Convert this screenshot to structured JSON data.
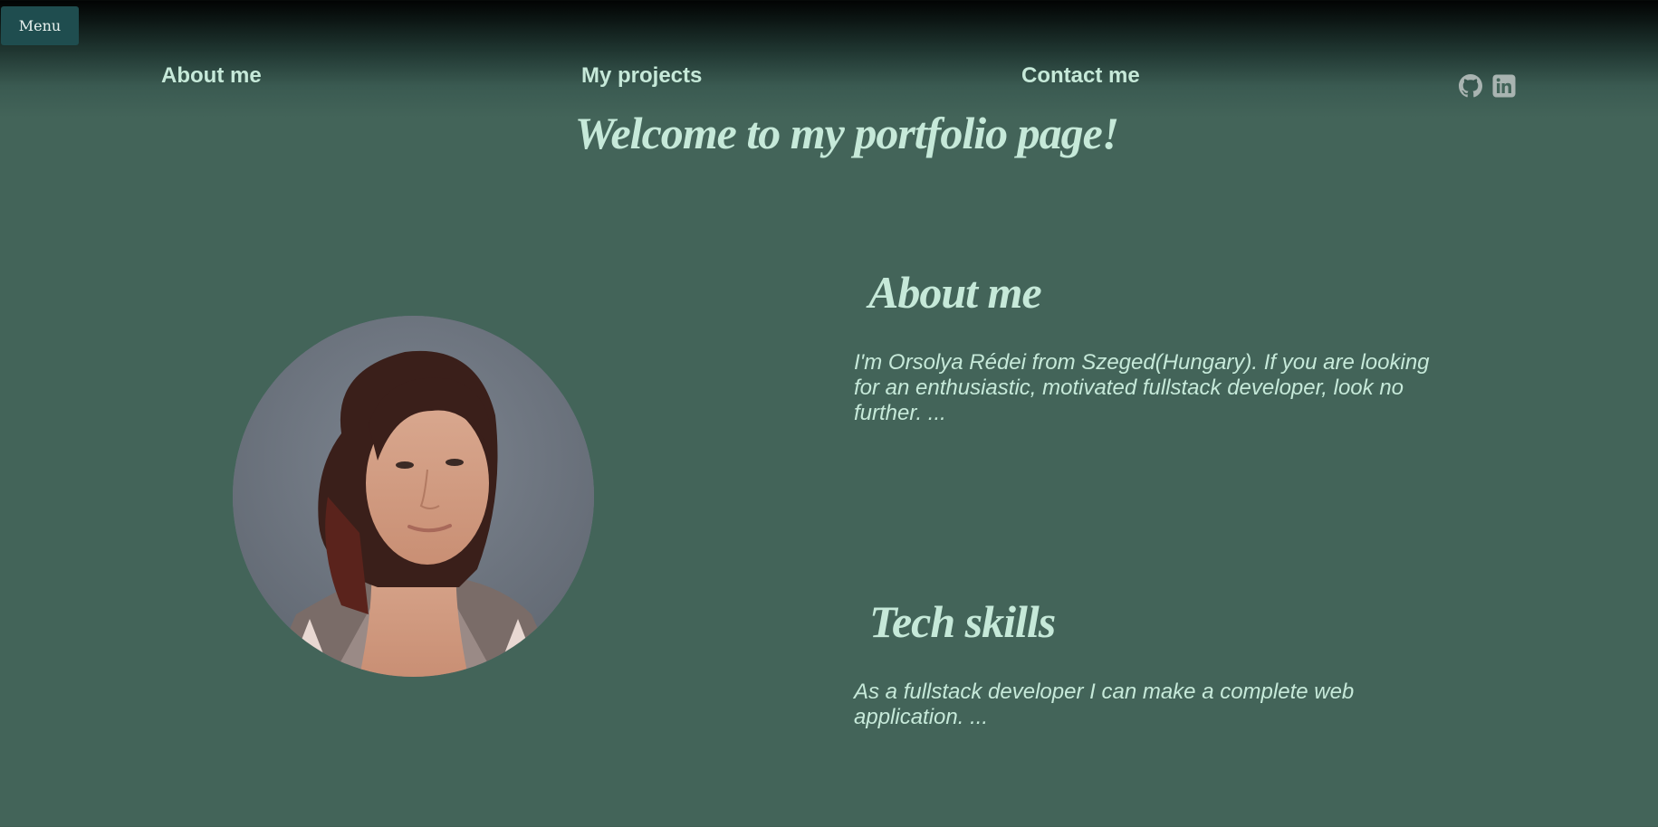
{
  "menu": {
    "label": "Menu"
  },
  "nav": {
    "items": [
      {
        "label": "About me"
      },
      {
        "label": "My projects"
      },
      {
        "label": "Contact me"
      }
    ]
  },
  "social": [
    {
      "icon": "github-icon",
      "color": "#a9b4b1"
    },
    {
      "icon": "linkedin-icon",
      "color": "#a9b4b1"
    }
  ],
  "hero": {
    "title": "Welcome to my portfolio page!"
  },
  "about": {
    "title": "About me",
    "text": "I'm Orsolya Rédei from Szeged(Hungary). If you are looking for an enthusiastic, motivated fullstack developer, look no further. ..."
  },
  "skills": {
    "title": "Tech skills",
    "text": "As a fullstack developer I can make a complete web application. ..."
  },
  "colors": {
    "background": "#436459",
    "text": "#c6e9d9",
    "menu_button": "#1f4d4f",
    "icon": "#a9b4b1"
  }
}
